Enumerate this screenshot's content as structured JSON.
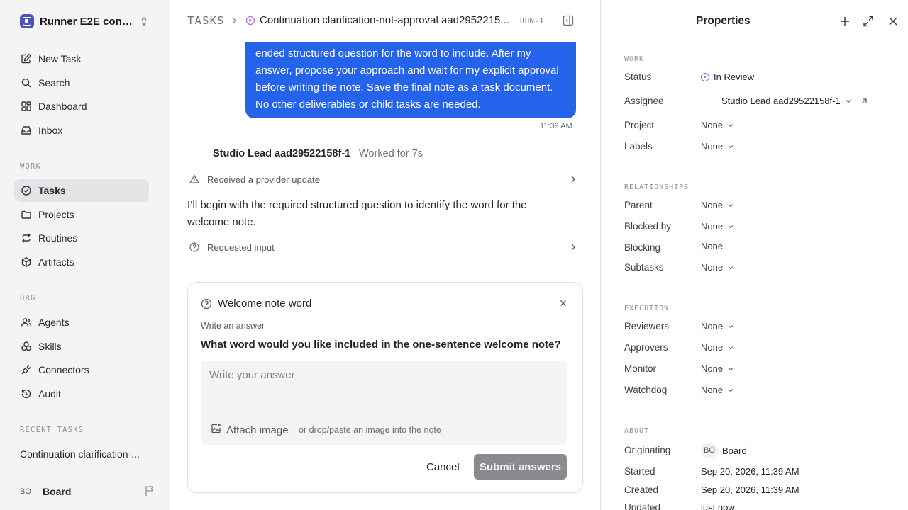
{
  "sidebar": {
    "workspace_name": "Runner E2E conti...",
    "nav": [
      {
        "label": "New Task",
        "icon": "edit-icon"
      },
      {
        "label": "Search",
        "icon": "search-icon"
      },
      {
        "label": "Dashboard",
        "icon": "dashboard-icon"
      },
      {
        "label": "Inbox",
        "icon": "inbox-icon"
      }
    ],
    "work_label": "WORK",
    "work_items": [
      {
        "label": "Tasks",
        "icon": "check-circle-icon",
        "active": true
      },
      {
        "label": "Projects",
        "icon": "folder-icon"
      },
      {
        "label": "Routines",
        "icon": "repeat-icon"
      },
      {
        "label": "Artifacts",
        "icon": "box-icon"
      }
    ],
    "org_label": "ORG",
    "org_items": [
      {
        "label": "Agents",
        "icon": "users-icon"
      },
      {
        "label": "Skills",
        "icon": "skills-icon"
      },
      {
        "label": "Connectors",
        "icon": "plug-icon"
      },
      {
        "label": "Audit",
        "icon": "history-icon"
      }
    ],
    "recent_label": "RECENT TASKS",
    "recent_task": "Continuation clarification-...",
    "user": {
      "initials": "BO",
      "name": "Board"
    }
  },
  "header": {
    "crumb": "TASKS",
    "title": "Continuation clarification-not-approval aad2952215...",
    "run_badge": "RUN-1"
  },
  "conversation": {
    "user_message": "ended structured question for the word to include. After my answer, propose your approach and wait for my explicit approval before writing the note. Save the final note as a task document. No other deliverables or child tasks are needed.",
    "user_time": "11:39 AM",
    "agent_name": "Studio Lead aad29522158f-1",
    "agent_meta": "Worked for 7s",
    "event_update": "Received a provider update",
    "agent_text": "I’ll begin with the required structured question to identify the word for the welcome note.",
    "event_input": "Requested input"
  },
  "question": {
    "title": "Welcome note word",
    "label": "Write an answer",
    "prompt": "What would you like included in the one-sentence welcome note?",
    "prompt_full": "What word would you like included in the one-sentence welcome note?",
    "placeholder": "Write your answer",
    "attach_label": "Attach image",
    "attach_hint": "or drop/paste an image into the note",
    "cancel_label": "Cancel",
    "submit_label": "Submit answers"
  },
  "properties": {
    "title": "Properties",
    "work_label": "WORK",
    "status_key": "Status",
    "status_val": "In Review",
    "assignee_key": "Assignee",
    "assignee_val": "Studio Lead aad29522158f-1",
    "project_key": "Project",
    "project_val": "None",
    "labels_key": "Labels",
    "labels_val": "None",
    "rel_label": "RELATIONSHIPS",
    "parent_key": "Parent",
    "parent_val": "None",
    "blockedby_key": "Blocked by",
    "blockedby_val": "None",
    "blocking_key": "Blocking",
    "blocking_val": "None",
    "subtasks_key": "Subtasks",
    "subtasks_val": "None",
    "exec_label": "EXECUTION",
    "reviewers_key": "Reviewers",
    "reviewers_val": "None",
    "approvers_key": "Approvers",
    "approvers_val": "None",
    "monitor_key": "Monitor",
    "monitor_val": "None",
    "watchdog_key": "Watchdog",
    "watchdog_val": "None",
    "about_label": "ABOUT",
    "orig_key": "Originating",
    "orig_initials": "BO",
    "orig_val": "Board",
    "started_key": "Started",
    "started_val": "Sep 20, 2026, 11:39 AM",
    "created_key": "Created",
    "created_val": "Sep 20, 2026, 11:39 AM",
    "updated_key": "Updated",
    "updated_val": "just now"
  }
}
